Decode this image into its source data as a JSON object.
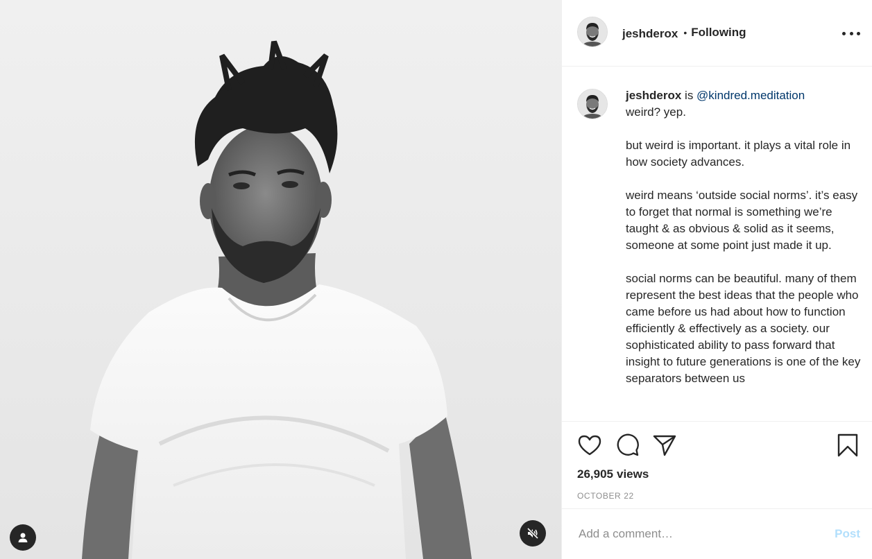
{
  "header": {
    "username": "jeshderox",
    "separator": "•",
    "follow_status": "Following",
    "more_icon": "more-horizontal-icon"
  },
  "caption": {
    "username": "jeshderox",
    "text_before_mention": " is ",
    "mention": "@kindred.meditation",
    "paragraphs": [
      "weird? yep.",
      "but weird is important. it plays a vital role in how society advances.",
      "weird means ‘outside social norms’. it’s easy to forget that normal is something we’re taught & as obvious & solid as it seems, someone at some point just made it up.",
      "social norms can be beautiful. many of them represent the best ideas that the people who came before us had about how to function efficiently & effectively as a society. our sophisticated ability to pass forward that insight to future generations is one of the key separators between us"
    ]
  },
  "actions": {
    "like_icon": "heart-icon",
    "comment_icon": "comment-bubble-icon",
    "share_icon": "paper-plane-icon",
    "save_icon": "bookmark-icon"
  },
  "stats": {
    "views_count": "26,905",
    "views_label": "views",
    "date": "OCTOBER 22"
  },
  "comment_box": {
    "placeholder": "Add a comment…",
    "post_label": "Post"
  },
  "media": {
    "tag_icon": "user-tag-icon",
    "mute_icon": "speaker-muted-icon"
  },
  "colors": {
    "text": "#262626",
    "secondary": "#8e8e8e",
    "mention": "#00376b",
    "post_disabled": "#b2dffc",
    "divider": "#efefef"
  }
}
